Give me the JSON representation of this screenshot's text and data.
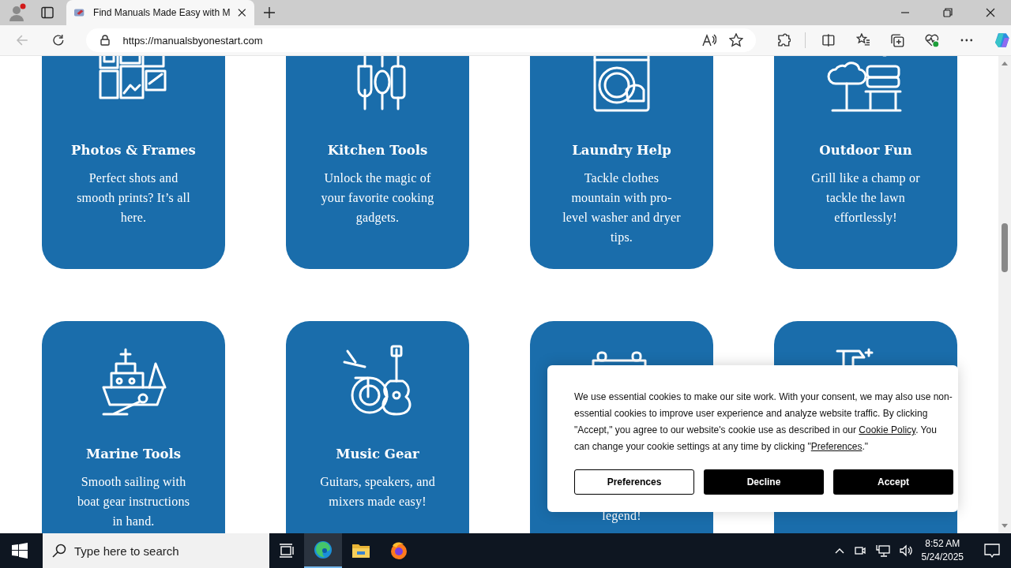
{
  "browser": {
    "tab_title": "Find Manuals Made Easy with M",
    "url": "https://manualsbyonestart.com"
  },
  "cards": [
    {
      "title": "Photos & Frames",
      "description": "Perfect shots and smooth prints? It’s all here."
    },
    {
      "title": "Kitchen Tools",
      "description": "Unlock the magic of your favorite cooking gadgets."
    },
    {
      "title": "Laundry Help",
      "description": "Tackle clothes mountain with pro-level washer and dryer tips."
    },
    {
      "title": "Outdoor Fun",
      "description": "Grill like a champ or tackle the lawn effortlessly!"
    },
    {
      "title": "Marine Tools",
      "description": "Smooth sailing with boat gear instructions in hand."
    },
    {
      "title": "Music Gear",
      "description": "Guitars, speakers, and mixers made easy!"
    },
    {
      "description": "legend!"
    }
  ],
  "cookie_banner": {
    "text_start": "We use essential cookies to make our site work. With your consent, we may also use non-essential cookies to improve user experience and analyze website traffic. By clicking \"Accept,\" you agree to our website's cookie use as described in our ",
    "policy_link": "Cookie Policy",
    "text_middle": ". You can change your cookie settings at any time by clicking \"",
    "preferences_link": "Preferences",
    "text_end": ".\"",
    "buttons": [
      {
        "label": "Preferences",
        "kind": "outline"
      },
      {
        "label": "Decline",
        "kind": "solid"
      },
      {
        "label": "Accept",
        "kind": "solid"
      }
    ]
  },
  "taskbar": {
    "search_placeholder": "Type here to search",
    "time": "8:52 AM",
    "date": "5/24/2025"
  }
}
